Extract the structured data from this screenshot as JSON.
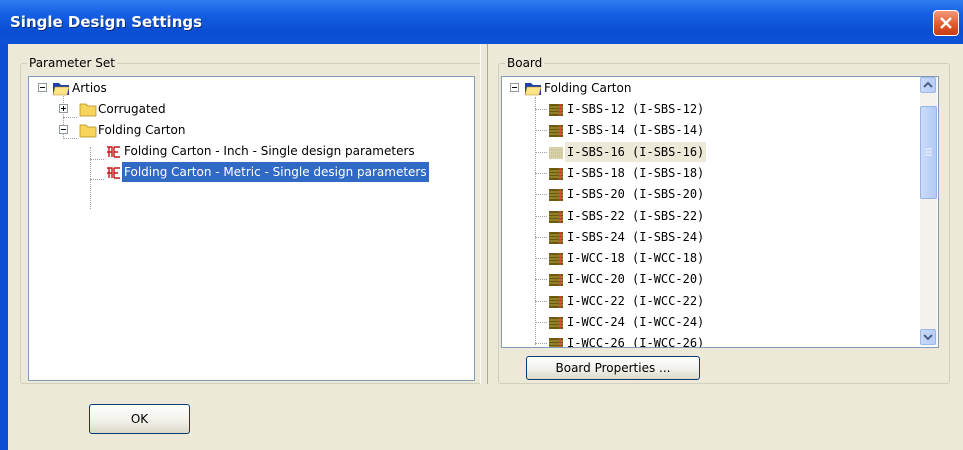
{
  "window": {
    "title": "Single Design Settings"
  },
  "parameter_set": {
    "title": "Parameter Set",
    "tree": {
      "root": "Artios",
      "corrugated": "Corrugated",
      "folding_carton": "Folding Carton",
      "inch_item": "Folding Carton - Inch - Single design parameters",
      "metric_item": "Folding Carton - Metric - Single design parameters",
      "selected": "Folding Carton - Metric - Single design parameters"
    }
  },
  "board": {
    "title": "Board",
    "root": "Folding Carton",
    "items": [
      "I-SBS-12 (I-SBS-12)",
      "I-SBS-14 (I-SBS-14)",
      "I-SBS-16 (I-SBS-16)",
      "I-SBS-18 (I-SBS-18)",
      "I-SBS-20 (I-SBS-20)",
      "I-SBS-22 (I-SBS-22)",
      "I-SBS-24 (I-SBS-24)",
      "I-WCC-18 (I-WCC-18)",
      "I-WCC-20 (I-WCC-20)",
      "I-WCC-22 (I-WCC-22)",
      "I-WCC-24 (I-WCC-24)",
      "I-WCC-26 (I-WCC-26)"
    ],
    "highlighted": "I-SBS-16 (I-SBS-16)",
    "properties_button": "Board Properties ..."
  },
  "buttons": {
    "ok": "OK"
  },
  "colors": {
    "titlebar": "#0c4fd6",
    "selection": "#316ac5",
    "dialog_bg": "#ece9d8",
    "close": "#e0562a"
  },
  "icons": {
    "folder": "folder-icon",
    "board": "board-icon",
    "parameter": "parameter-file-icon"
  }
}
